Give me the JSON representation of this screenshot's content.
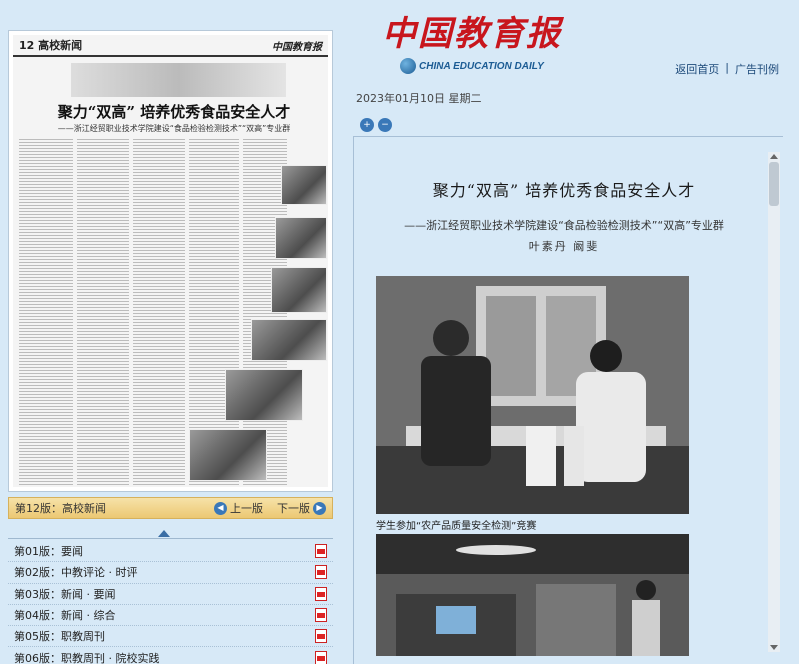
{
  "header": {
    "logo_cn": "中国教育报",
    "logo_en": "CHINA EDUCATION DAILY",
    "links": [
      "返回首页",
      "广告刊例"
    ],
    "link_sep": "|",
    "date": "2023年01月10日 星期二"
  },
  "thumbnail": {
    "page_number": "12 高校新闻",
    "logo": "中国教育报",
    "title": "聚力“双高” 培养优秀食品安全人才",
    "subtitle": "——浙江经贸职业技术学院建设“食品检验检测技术”“双高”专业群"
  },
  "page_bar": {
    "current": "第12版：高校新闻",
    "prev": "上一版",
    "next": "下一版"
  },
  "page_list": [
    "第01版：要闻",
    "第02版：中教评论 · 时评",
    "第03版：新闻 · 要闻",
    "第04版：新闻 · 综合",
    "第05版：职教周刊",
    "第06版：职教周刊 · 院校实践"
  ],
  "article": {
    "title": "聚力“双高”  培养优秀食品安全人才",
    "subtitle": "——浙江经贸职业技术学院建设“食品检验检测技术”“双高”专业群",
    "author": "叶素丹  阚斐",
    "caption1": "学生参加“农产品质量安全检测”竞赛"
  },
  "colors": {
    "accent": "#c8161d",
    "link": "#1d4a7a",
    "background": "#d7e9f7",
    "page_bar": "#ecc873"
  }
}
